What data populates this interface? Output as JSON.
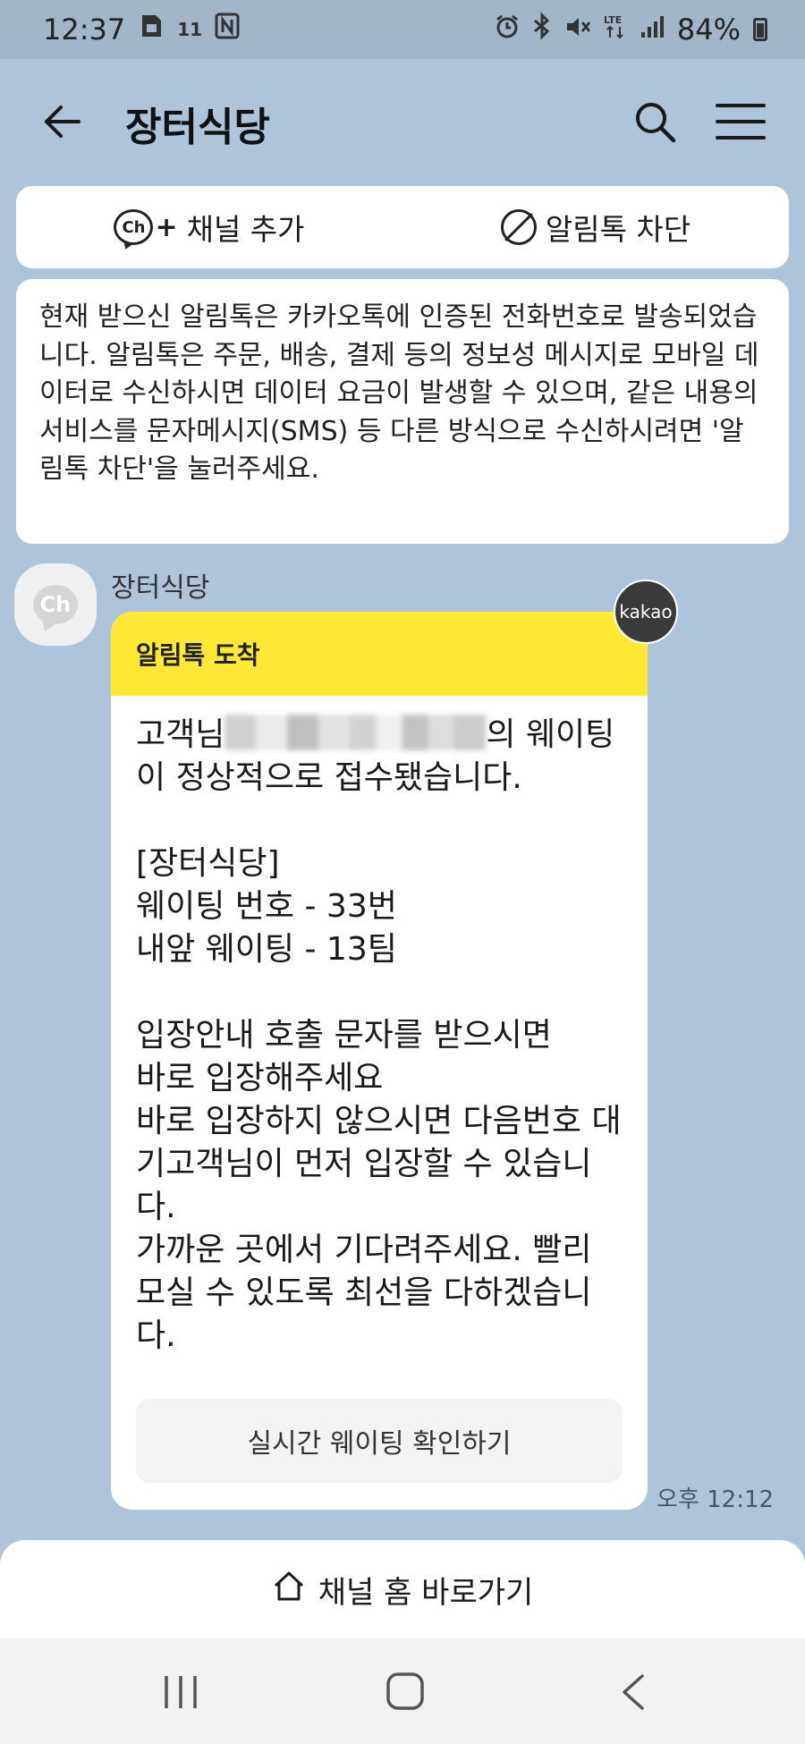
{
  "status_bar": {
    "time": "12:37",
    "left_badge": "11",
    "battery_percent": "84%",
    "icons": [
      "sim-card-icon",
      "nfc-icon",
      "alarm-icon",
      "bluetooth-icon",
      "mute-icon",
      "lte-icon",
      "signal-icon",
      "battery-icon"
    ]
  },
  "header": {
    "title": "장터식당",
    "icons": [
      "back-arrow-icon",
      "search-icon",
      "menu-icon"
    ]
  },
  "actions": {
    "add_channel_label": "채널 추가",
    "block_label": "알림톡 차단"
  },
  "notice": {
    "text": "현재 받으신 알림톡은 카카오톡에 인증된 전화번호로 발송되었습니다. 알림톡은 주문, 배송, 결제 등의 정보성 메시지로 모바일 데이터로 수신하시면 데이터 요금이 발생할 수 있으며, 같은 내용의 서비스를 문자메시지(SMS) 등 다른 방식으로 수신하시려면 '알림톡 차단'을 눌러주세요."
  },
  "message": {
    "sender": "장터식당",
    "badge": "kakao",
    "header": "알림톡 도착",
    "body_prefix": "고객님",
    "body": "의 웨이팅이 정상적으로 접수됐습니다.\n\n[장터식당]\n웨이팅 번호 - 33번\n내앞 웨이팅 - 13팀\n\n입장안내 호출 문자를 받으시면\n바로 입장해주세요\n바로 입장하지 않으시면 다음번호 대기고객님이 먼저 입장할 수 있습니다.\n가까운 곳에서 기다려주세요. 빨리 모실 수 있도록 최선을 다하겠습니다.",
    "button_label": "실시간 웨이팅 확인하기",
    "timestamp": "오후 12:12"
  },
  "channel_home": {
    "label": "채널 홈 바로가기"
  },
  "colors": {
    "chat_background": "#aec4da",
    "alert_header": "#fde934"
  }
}
